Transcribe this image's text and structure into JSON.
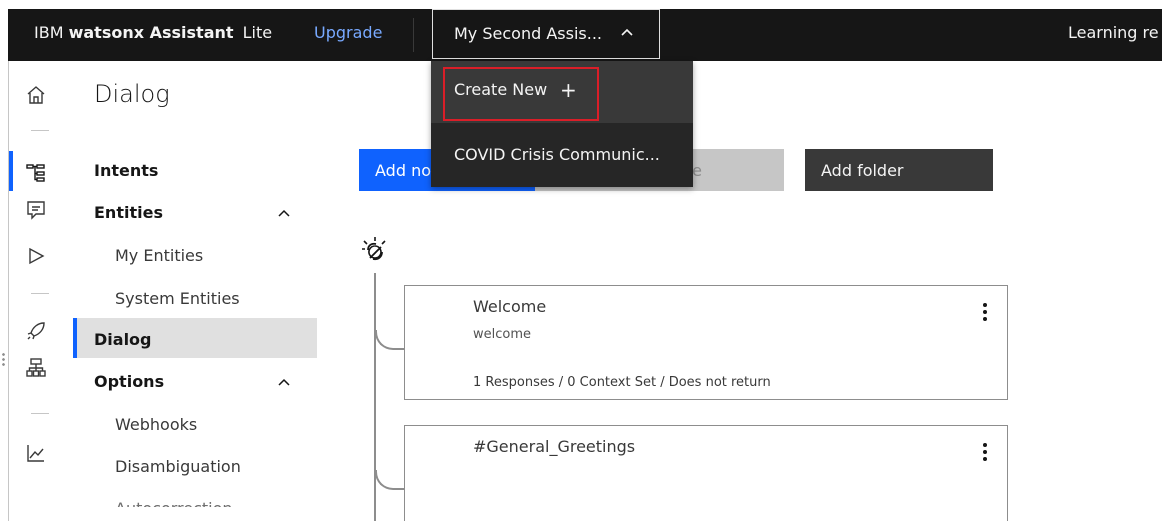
{
  "topbar": {
    "brand_prefix": "IBM",
    "brand_name": "watsonx Assistant",
    "brand_plan": "Lite",
    "upgrade_label": "Upgrade",
    "assistant_selector_label": "My Second Assis...",
    "learning_label": "Learning re"
  },
  "assistant_menu": {
    "items": [
      {
        "label": "Create New",
        "icon": "plus-icon"
      },
      {
        "label": "COVID Crisis Communic..."
      }
    ]
  },
  "rail": {
    "icons": [
      "home-icon",
      "skills-tree-icon",
      "chat-icon",
      "play-icon",
      "rocket-icon",
      "integrations-icon",
      "analytics-icon"
    ]
  },
  "page": {
    "title": "Dialog"
  },
  "secondary_nav": {
    "items": [
      {
        "label": "Intents",
        "level": "top"
      },
      {
        "label": "Entities",
        "level": "top",
        "expanded": true
      },
      {
        "label": "My Entities",
        "level": "sub"
      },
      {
        "label": "System Entities",
        "level": "sub"
      },
      {
        "label": "Dialog",
        "level": "top",
        "active": true
      },
      {
        "label": "Options",
        "level": "top",
        "expanded": true
      },
      {
        "label": "Webhooks",
        "level": "sub"
      },
      {
        "label": "Disambiguation",
        "level": "sub"
      },
      {
        "label": "Autocorrection",
        "level": "sub"
      }
    ]
  },
  "actions": {
    "add_node_label": "Add no",
    "add_child_label": "e",
    "add_folder_label": "Add folder"
  },
  "nodes": [
    {
      "title": "Welcome",
      "condition": "welcome",
      "meta": "1 Responses / 0 Context Set / Does not return"
    },
    {
      "title": "#General_Greetings",
      "condition": "",
      "meta": ""
    }
  ],
  "colors": {
    "accent": "#0f62fe",
    "topbar_bg": "#161616",
    "menu_bg": "#262626",
    "highlight": "#da1e28",
    "link": "#78a9ff"
  }
}
